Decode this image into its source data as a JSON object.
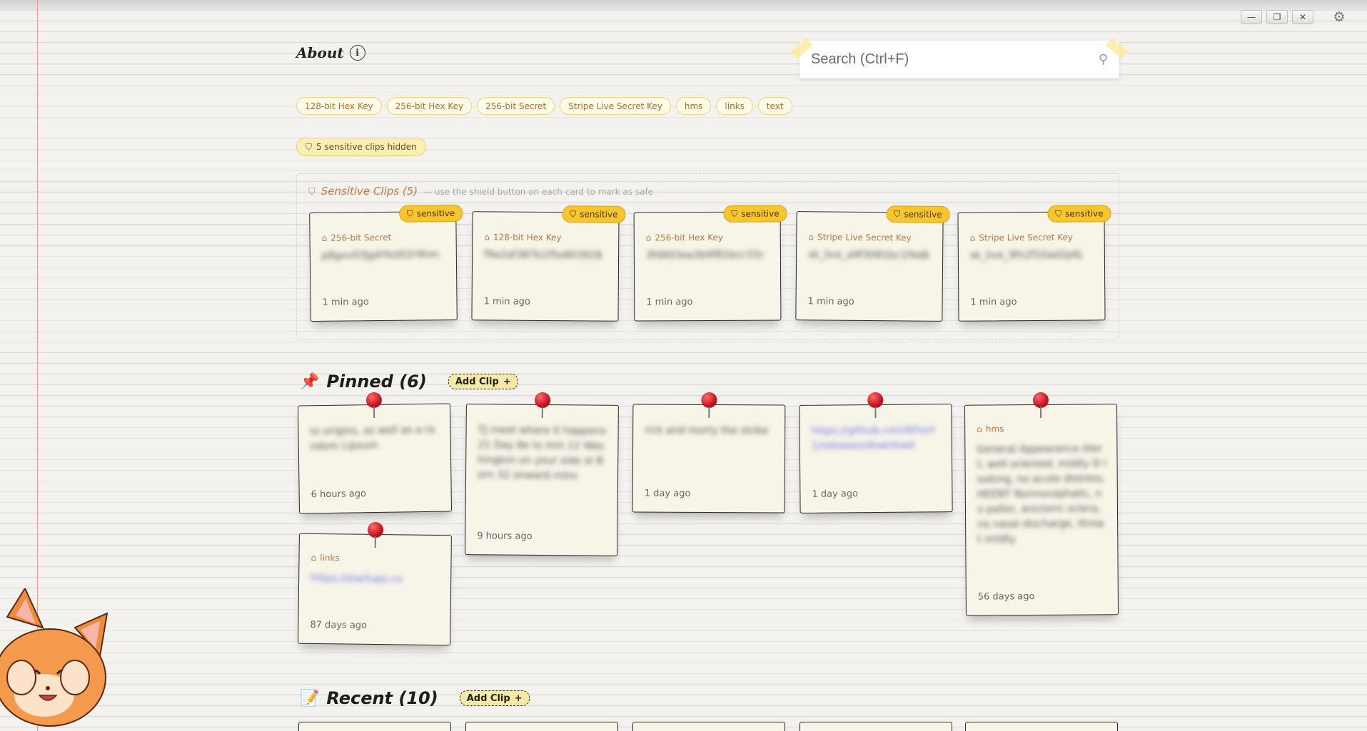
{
  "window": {
    "minimize_label": "—",
    "restore_label": "❐",
    "close_label": "✕",
    "settings_icon": "gear-icon"
  },
  "header": {
    "about_label": "About",
    "info_icon": "info-icon"
  },
  "search": {
    "placeholder": "Search (Ctrl+F)"
  },
  "tags": [
    "128-bit Hex Key",
    "256-bit Hex Key",
    "256-bit Secret",
    "Stripe Live Secret Key",
    "hms",
    "links",
    "text"
  ],
  "hidden_badge": "5 sensitive clips hidden",
  "sensitive": {
    "title": "Sensitive Clips (5)",
    "subtitle": "— use the shield button on each card to mark as safe",
    "badge_label": "sensitive",
    "cards": [
      {
        "tag": "256-bit Secret",
        "text": "p8gxv03Jg4YkdX2r9hm",
        "time": "1 min ago"
      },
      {
        "tag": "128-bit Hex Key",
        "text": "f9a2af387b1f5e803928",
        "time": "1 min ago"
      },
      {
        "tag": "256-bit Hex Key",
        "text": "3fd603ea3b9f81bcc33c",
        "time": "1 min ago"
      },
      {
        "tag": "Stripe Live Secret Key",
        "text": "sk_live_a9f3081bc1f4d8",
        "time": "1 min ago"
      },
      {
        "tag": "Stripe Live Secret Key",
        "text": "sk_live_9fn2f10ad2p6j",
        "time": "1 min ago"
      }
    ]
  },
  "pinned": {
    "title": "Pinned (6)",
    "add_label": "Add Clip",
    "cards": [
      {
        "tag": "",
        "text": "to origins, as well as a random Lipsum",
        "time": "6 hours ago",
        "link": false
      },
      {
        "tag": "",
        "text": "TJ meet where it happens 21 Day 8e to min 12 Washington on your side st Born 32 onward mins",
        "time": "9 hours ago",
        "link": false
      },
      {
        "tag": "",
        "text": "rick and morty the strike",
        "time": "1 day ago",
        "link": false
      },
      {
        "tag": "",
        "text": "https://github.com/bfxs/r1/releases/download",
        "time": "1 day ago",
        "link": true
      },
      {
        "tag": "hms",
        "text": "General Appearance Alert, well oriented, mildly ill looking, no acute distress. HEENT Normocephalic, no pallor, anicteric sclera, no nasal discharge, throat mildly.",
        "time": "56 days ago",
        "link": false
      },
      {
        "tag": "links",
        "text": "https://startups.co",
        "time": "87 days ago",
        "link": true
      }
    ]
  },
  "recent": {
    "title": "Recent (10)",
    "add_label": "Add Clip"
  }
}
